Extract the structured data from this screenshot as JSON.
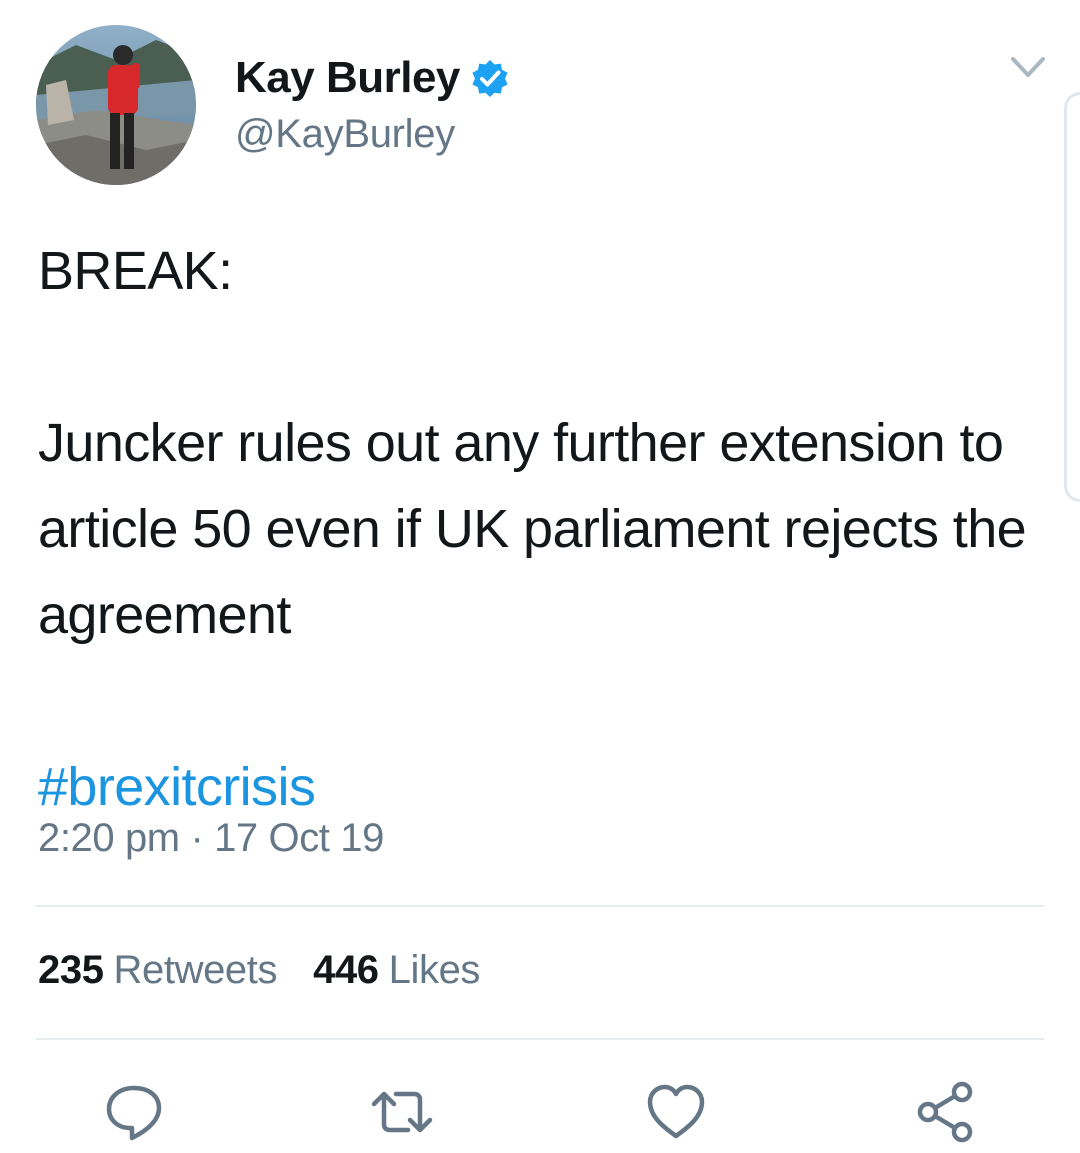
{
  "author": {
    "display_name": "Kay Burley",
    "handle": "@KayBurley",
    "verified": true,
    "avatar": "avatar-photo"
  },
  "tweet": {
    "lines": [
      "BREAK:",
      "Juncker rules out any further extension to article 50 even if UK parliament rejects the agreement",
      "#brexitcrisis"
    ],
    "timestamp": "2:20 pm · 17 Oct 19"
  },
  "stats": {
    "retweets_count": "235",
    "retweets_label": "Retweets",
    "likes_count": "446",
    "likes_label": "Likes"
  },
  "icons": {
    "menu": "chevron-down-icon",
    "reply": "reply-icon",
    "retweet": "retweet-icon",
    "like": "heart-icon",
    "share": "share-icon",
    "verified": "verified-badge-icon"
  },
  "colors": {
    "link": "#1b95e0",
    "text": "#14171a",
    "secondary": "#657786",
    "icon": "#657786",
    "divider": "#e6ecf0"
  }
}
